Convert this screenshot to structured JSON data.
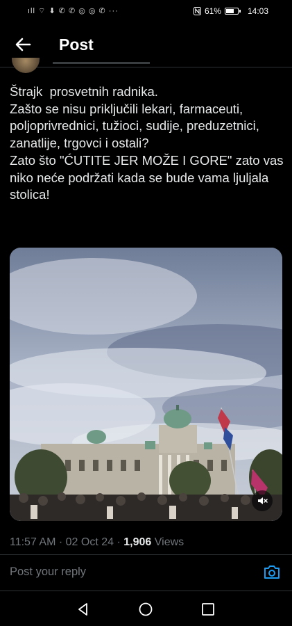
{
  "status_bar": {
    "signal_icons": "ıll ⌔ ⬇ ✆ ✆ ◎ ◎ ✆ ···",
    "nfc_icon": "nfc-icon",
    "battery_percent": "61%",
    "battery_level": 0.61,
    "time": "14:03"
  },
  "header": {
    "title": "Post",
    "back_icon": "arrow-left-icon"
  },
  "tweet": {
    "text": "Štrajk  prosvetnih radnika.\nZašto se nisu priključili lekari, farmaceuti, poljoprivrednici, tužioci, sudije, preduzetnici, zanatlije, trgovci i ostali?\nZato što \"ĆUTITE JER MOŽE I GORE\" zato vas niko neće podržati kada se bude vama ljuljala stolica!",
    "media": {
      "mute_icon": "speaker-muted-icon"
    },
    "time": "11:57 AM",
    "date": "02 Oct 24",
    "separator": "·",
    "views_count": "1,906",
    "views_label": "Views"
  },
  "reply": {
    "placeholder": "Post your reply",
    "camera_icon": "camera-icon"
  },
  "nav_bar": {
    "back_icon": "triangle-back-icon",
    "home_icon": "circle-home-icon",
    "recents_icon": "square-recents-icon"
  },
  "colors": {
    "background": "#000000",
    "text": "#e7e9ea",
    "muted": "#71767b",
    "accent": "#1d9bf0",
    "divider": "#2f3336"
  }
}
